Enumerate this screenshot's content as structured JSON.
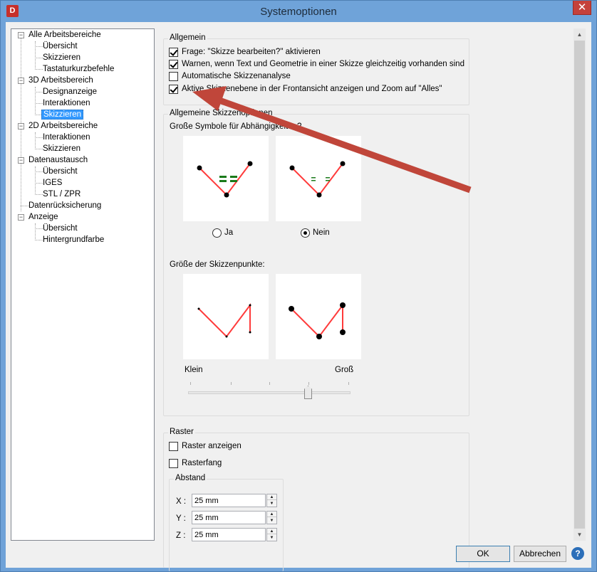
{
  "window": {
    "title": "Systemoptionen",
    "app_icon_letter": "D",
    "close_glyph": "✕"
  },
  "tree": {
    "items": [
      {
        "label": "Alle Arbeitsbereiche",
        "level": 0,
        "expandable": true
      },
      {
        "label": "Übersicht",
        "level": 1
      },
      {
        "label": "Skizzieren",
        "level": 1
      },
      {
        "label": "Tastaturkurzbefehle",
        "level": 1
      },
      {
        "label": "3D Arbeitsbereich",
        "level": 0,
        "expandable": true
      },
      {
        "label": "Designanzeige",
        "level": 1
      },
      {
        "label": "Interaktionen",
        "level": 1
      },
      {
        "label": "Skizzieren",
        "level": 1,
        "selected": true
      },
      {
        "label": "2D Arbeitsbereiche",
        "level": 0,
        "expandable": true
      },
      {
        "label": "Interaktionen",
        "level": 1
      },
      {
        "label": "Skizzieren",
        "level": 1
      },
      {
        "label": "Datenaustausch",
        "level": 0,
        "expandable": true
      },
      {
        "label": "Übersicht",
        "level": 1
      },
      {
        "label": "IGES",
        "level": 1
      },
      {
        "label": "STL / ZPR",
        "level": 1
      },
      {
        "label": "Datenrücksicherung",
        "level": 0
      },
      {
        "label": "Anzeige",
        "level": 0,
        "expandable": true
      },
      {
        "label": "Übersicht",
        "level": 1
      },
      {
        "label": "Hintergrundfarbe",
        "level": 1
      }
    ]
  },
  "allgemein": {
    "title": "Allgemein",
    "options": [
      {
        "label": "Frage: \"Skizze bearbeiten?\" aktivieren",
        "checked": true
      },
      {
        "label": "Warnen, wenn Text und Geometrie in einer Skizze gleichzeitig vorhanden sind",
        "checked": true
      },
      {
        "label": "Automatische Skizzenanalyse",
        "checked": false
      },
      {
        "label": "Aktive Skizzenebene in der Frontansicht anzeigen und Zoom auf \"Alles\"",
        "checked": true
      }
    ]
  },
  "skizzenoptionen": {
    "title": "Allgemeine Skizzenoptionen",
    "symbols_label": "Große Symbole für Abhängigkeiten?",
    "radio_yes": "Ja",
    "radio_no": "Nein",
    "radio_selected": "Nein",
    "points_label": "Größe der Skizzenpunkte:",
    "slider_min_label": "Klein",
    "slider_max_label": "Groß",
    "slider_value_fraction": 0.75
  },
  "raster": {
    "title": "Raster",
    "show_label": "Raster anzeigen",
    "show_checked": false,
    "snap_label": "Rasterfang",
    "snap_checked": false,
    "spacing_title": "Abstand",
    "x_label": "X :",
    "x_value": "25 mm",
    "y_label": "Y :",
    "y_value": "25 mm",
    "z_label": "Z :",
    "z_value": "25 mm"
  },
  "buttons": {
    "ok": "OK",
    "cancel": "Abbrechen",
    "help": "?"
  },
  "colors": {
    "title_bar": "#6fa3d9",
    "selection": "#3399ff",
    "sketch_line": "#ff3b3b",
    "constraint_symbol": "#1a7a1a",
    "annotation_arrow": "#c0463a",
    "close_button": "#c5413a"
  }
}
